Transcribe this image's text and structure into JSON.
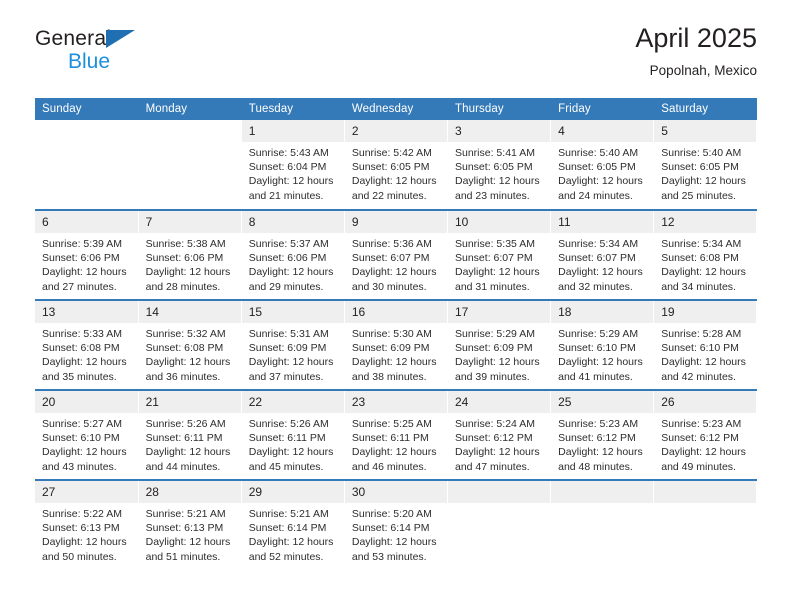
{
  "brand": {
    "name_part1": "General",
    "name_part2": "Blue",
    "triangle_color": "#1f6fb2",
    "blue_color": "#1d8fe0"
  },
  "header": {
    "title": "April 2025",
    "location": "Popolnah, Mexico"
  },
  "theme": {
    "header_blue": "#3479b8",
    "daynum_band": "#efefef",
    "text": "#231f20"
  },
  "calendar": {
    "weekday_headers": [
      "Sunday",
      "Monday",
      "Tuesday",
      "Wednesday",
      "Thursday",
      "Friday",
      "Saturday"
    ],
    "labels": {
      "sunrise": "Sunrise:",
      "sunset": "Sunset:",
      "daylight": "Daylight:"
    },
    "weeks": [
      [
        {
          "day": "",
          "blank": true
        },
        {
          "day": "",
          "blank": true
        },
        {
          "day": "1",
          "sunrise": "Sunrise: 5:43 AM",
          "sunset": "Sunset: 6:04 PM",
          "daylight1": "Daylight: 12 hours",
          "daylight2": "and 21 minutes."
        },
        {
          "day": "2",
          "sunrise": "Sunrise: 5:42 AM",
          "sunset": "Sunset: 6:05 PM",
          "daylight1": "Daylight: 12 hours",
          "daylight2": "and 22 minutes."
        },
        {
          "day": "3",
          "sunrise": "Sunrise: 5:41 AM",
          "sunset": "Sunset: 6:05 PM",
          "daylight1": "Daylight: 12 hours",
          "daylight2": "and 23 minutes."
        },
        {
          "day": "4",
          "sunrise": "Sunrise: 5:40 AM",
          "sunset": "Sunset: 6:05 PM",
          "daylight1": "Daylight: 12 hours",
          "daylight2": "and 24 minutes."
        },
        {
          "day": "5",
          "sunrise": "Sunrise: 5:40 AM",
          "sunset": "Sunset: 6:05 PM",
          "daylight1": "Daylight: 12 hours",
          "daylight2": "and 25 minutes."
        }
      ],
      [
        {
          "day": "6",
          "sunrise": "Sunrise: 5:39 AM",
          "sunset": "Sunset: 6:06 PM",
          "daylight1": "Daylight: 12 hours",
          "daylight2": "and 27 minutes."
        },
        {
          "day": "7",
          "sunrise": "Sunrise: 5:38 AM",
          "sunset": "Sunset: 6:06 PM",
          "daylight1": "Daylight: 12 hours",
          "daylight2": "and 28 minutes."
        },
        {
          "day": "8",
          "sunrise": "Sunrise: 5:37 AM",
          "sunset": "Sunset: 6:06 PM",
          "daylight1": "Daylight: 12 hours",
          "daylight2": "and 29 minutes."
        },
        {
          "day": "9",
          "sunrise": "Sunrise: 5:36 AM",
          "sunset": "Sunset: 6:07 PM",
          "daylight1": "Daylight: 12 hours",
          "daylight2": "and 30 minutes."
        },
        {
          "day": "10",
          "sunrise": "Sunrise: 5:35 AM",
          "sunset": "Sunset: 6:07 PM",
          "daylight1": "Daylight: 12 hours",
          "daylight2": "and 31 minutes."
        },
        {
          "day": "11",
          "sunrise": "Sunrise: 5:34 AM",
          "sunset": "Sunset: 6:07 PM",
          "daylight1": "Daylight: 12 hours",
          "daylight2": "and 32 minutes."
        },
        {
          "day": "12",
          "sunrise": "Sunrise: 5:34 AM",
          "sunset": "Sunset: 6:08 PM",
          "daylight1": "Daylight: 12 hours",
          "daylight2": "and 34 minutes."
        }
      ],
      [
        {
          "day": "13",
          "sunrise": "Sunrise: 5:33 AM",
          "sunset": "Sunset: 6:08 PM",
          "daylight1": "Daylight: 12 hours",
          "daylight2": "and 35 minutes."
        },
        {
          "day": "14",
          "sunrise": "Sunrise: 5:32 AM",
          "sunset": "Sunset: 6:08 PM",
          "daylight1": "Daylight: 12 hours",
          "daylight2": "and 36 minutes."
        },
        {
          "day": "15",
          "sunrise": "Sunrise: 5:31 AM",
          "sunset": "Sunset: 6:09 PM",
          "daylight1": "Daylight: 12 hours",
          "daylight2": "and 37 minutes."
        },
        {
          "day": "16",
          "sunrise": "Sunrise: 5:30 AM",
          "sunset": "Sunset: 6:09 PM",
          "daylight1": "Daylight: 12 hours",
          "daylight2": "and 38 minutes."
        },
        {
          "day": "17",
          "sunrise": "Sunrise: 5:29 AM",
          "sunset": "Sunset: 6:09 PM",
          "daylight1": "Daylight: 12 hours",
          "daylight2": "and 39 minutes."
        },
        {
          "day": "18",
          "sunrise": "Sunrise: 5:29 AM",
          "sunset": "Sunset: 6:10 PM",
          "daylight1": "Daylight: 12 hours",
          "daylight2": "and 41 minutes."
        },
        {
          "day": "19",
          "sunrise": "Sunrise: 5:28 AM",
          "sunset": "Sunset: 6:10 PM",
          "daylight1": "Daylight: 12 hours",
          "daylight2": "and 42 minutes."
        }
      ],
      [
        {
          "day": "20",
          "sunrise": "Sunrise: 5:27 AM",
          "sunset": "Sunset: 6:10 PM",
          "daylight1": "Daylight: 12 hours",
          "daylight2": "and 43 minutes."
        },
        {
          "day": "21",
          "sunrise": "Sunrise: 5:26 AM",
          "sunset": "Sunset: 6:11 PM",
          "daylight1": "Daylight: 12 hours",
          "daylight2": "and 44 minutes."
        },
        {
          "day": "22",
          "sunrise": "Sunrise: 5:26 AM",
          "sunset": "Sunset: 6:11 PM",
          "daylight1": "Daylight: 12 hours",
          "daylight2": "and 45 minutes."
        },
        {
          "day": "23",
          "sunrise": "Sunrise: 5:25 AM",
          "sunset": "Sunset: 6:11 PM",
          "daylight1": "Daylight: 12 hours",
          "daylight2": "and 46 minutes."
        },
        {
          "day": "24",
          "sunrise": "Sunrise: 5:24 AM",
          "sunset": "Sunset: 6:12 PM",
          "daylight1": "Daylight: 12 hours",
          "daylight2": "and 47 minutes."
        },
        {
          "day": "25",
          "sunrise": "Sunrise: 5:23 AM",
          "sunset": "Sunset: 6:12 PM",
          "daylight1": "Daylight: 12 hours",
          "daylight2": "and 48 minutes."
        },
        {
          "day": "26",
          "sunrise": "Sunrise: 5:23 AM",
          "sunset": "Sunset: 6:12 PM",
          "daylight1": "Daylight: 12 hours",
          "daylight2": "and 49 minutes."
        }
      ],
      [
        {
          "day": "27",
          "sunrise": "Sunrise: 5:22 AM",
          "sunset": "Sunset: 6:13 PM",
          "daylight1": "Daylight: 12 hours",
          "daylight2": "and 50 minutes."
        },
        {
          "day": "28",
          "sunrise": "Sunrise: 5:21 AM",
          "sunset": "Sunset: 6:13 PM",
          "daylight1": "Daylight: 12 hours",
          "daylight2": "and 51 minutes."
        },
        {
          "day": "29",
          "sunrise": "Sunrise: 5:21 AM",
          "sunset": "Sunset: 6:14 PM",
          "daylight1": "Daylight: 12 hours",
          "daylight2": "and 52 minutes."
        },
        {
          "day": "30",
          "sunrise": "Sunrise: 5:20 AM",
          "sunset": "Sunset: 6:14 PM",
          "daylight1": "Daylight: 12 hours",
          "daylight2": "and 53 minutes."
        },
        {
          "day": "",
          "empty": true
        },
        {
          "day": "",
          "empty": true
        },
        {
          "day": "",
          "empty": true
        }
      ]
    ]
  }
}
